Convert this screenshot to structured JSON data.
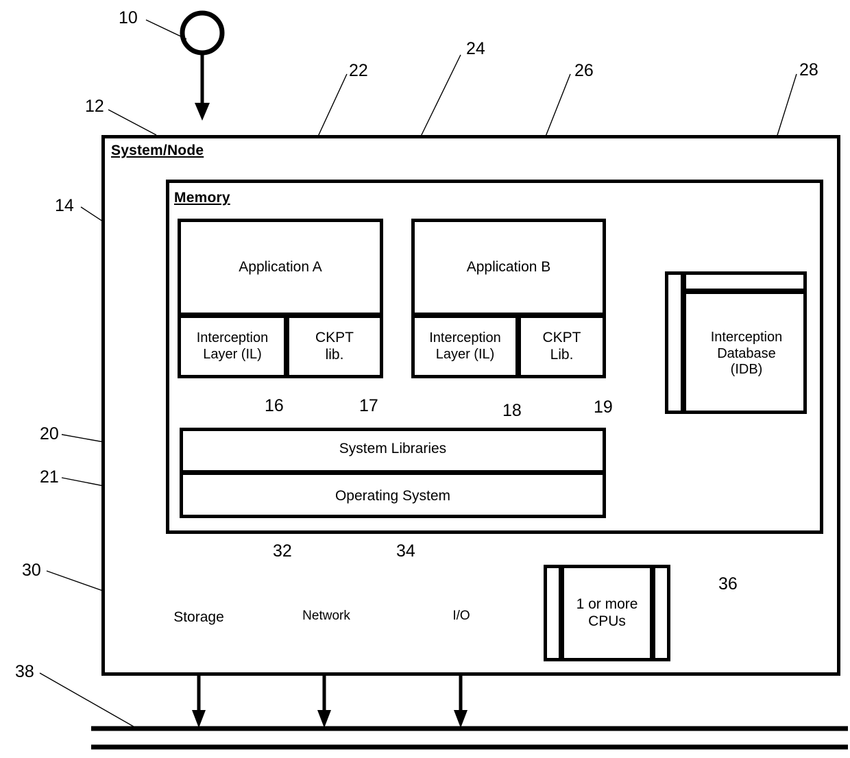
{
  "figure": {
    "type": "patent-block-diagram",
    "title": "System/Node architecture with application interception layers"
  },
  "containers": {
    "system_node": {
      "label": "System/Node",
      "ref": "12"
    },
    "memory": {
      "label": "Memory",
      "ref": "14"
    }
  },
  "applications": [
    {
      "name": "Application A",
      "ref": "22",
      "sublayers": [
        {
          "line1": "Interception",
          "line2": "Layer (IL)",
          "ref": "16"
        },
        {
          "line1": "CKPT",
          "line2": "lib.",
          "ref": "17"
        }
      ]
    },
    {
      "name": "Application B",
      "ref": "26",
      "sublayers": [
        {
          "line1": "Interception",
          "line2": "Layer (IL)",
          "ref": "18"
        },
        {
          "line1": "CKPT",
          "line2": "Lib.",
          "ref": "19"
        }
      ]
    }
  ],
  "database": {
    "line1": "Interception",
    "line2": "Database",
    "line3": "(IDB)",
    "ref": "28"
  },
  "software_stack": [
    {
      "label": "System Libraries",
      "ref": "20"
    },
    {
      "label": "Operating System",
      "ref": "21"
    }
  ],
  "hardware": [
    {
      "label": "Storage",
      "ref": "30",
      "shape": "cylinder"
    },
    {
      "label": "Network",
      "ref": "32",
      "shape": "trapezoid"
    },
    {
      "label": "I/O",
      "ref": "34",
      "shape": "trapezoid"
    },
    {
      "line1": "1 or more",
      "line2": "CPUs",
      "ref": "36",
      "shape": "cpu-box"
    }
  ],
  "bus": {
    "ref": "38",
    "style": "double-line"
  },
  "entry_point": {
    "ref": "10",
    "shape": "circle-with-arrow"
  },
  "separator": {
    "ref": "24",
    "style": "vertical-dashed"
  },
  "reference_numerals": {
    "n10": "10",
    "n12": "12",
    "n14": "14",
    "n16": "16",
    "n17": "17",
    "n18": "18",
    "n19": "19",
    "n20": "20",
    "n21": "21",
    "n22": "22",
    "n24": "24",
    "n26": "26",
    "n28": "28",
    "n30": "30",
    "n32": "32",
    "n34": "34",
    "n36": "36",
    "n38": "38"
  },
  "colors": {
    "stroke": "#000000",
    "background": "#ffffff"
  }
}
